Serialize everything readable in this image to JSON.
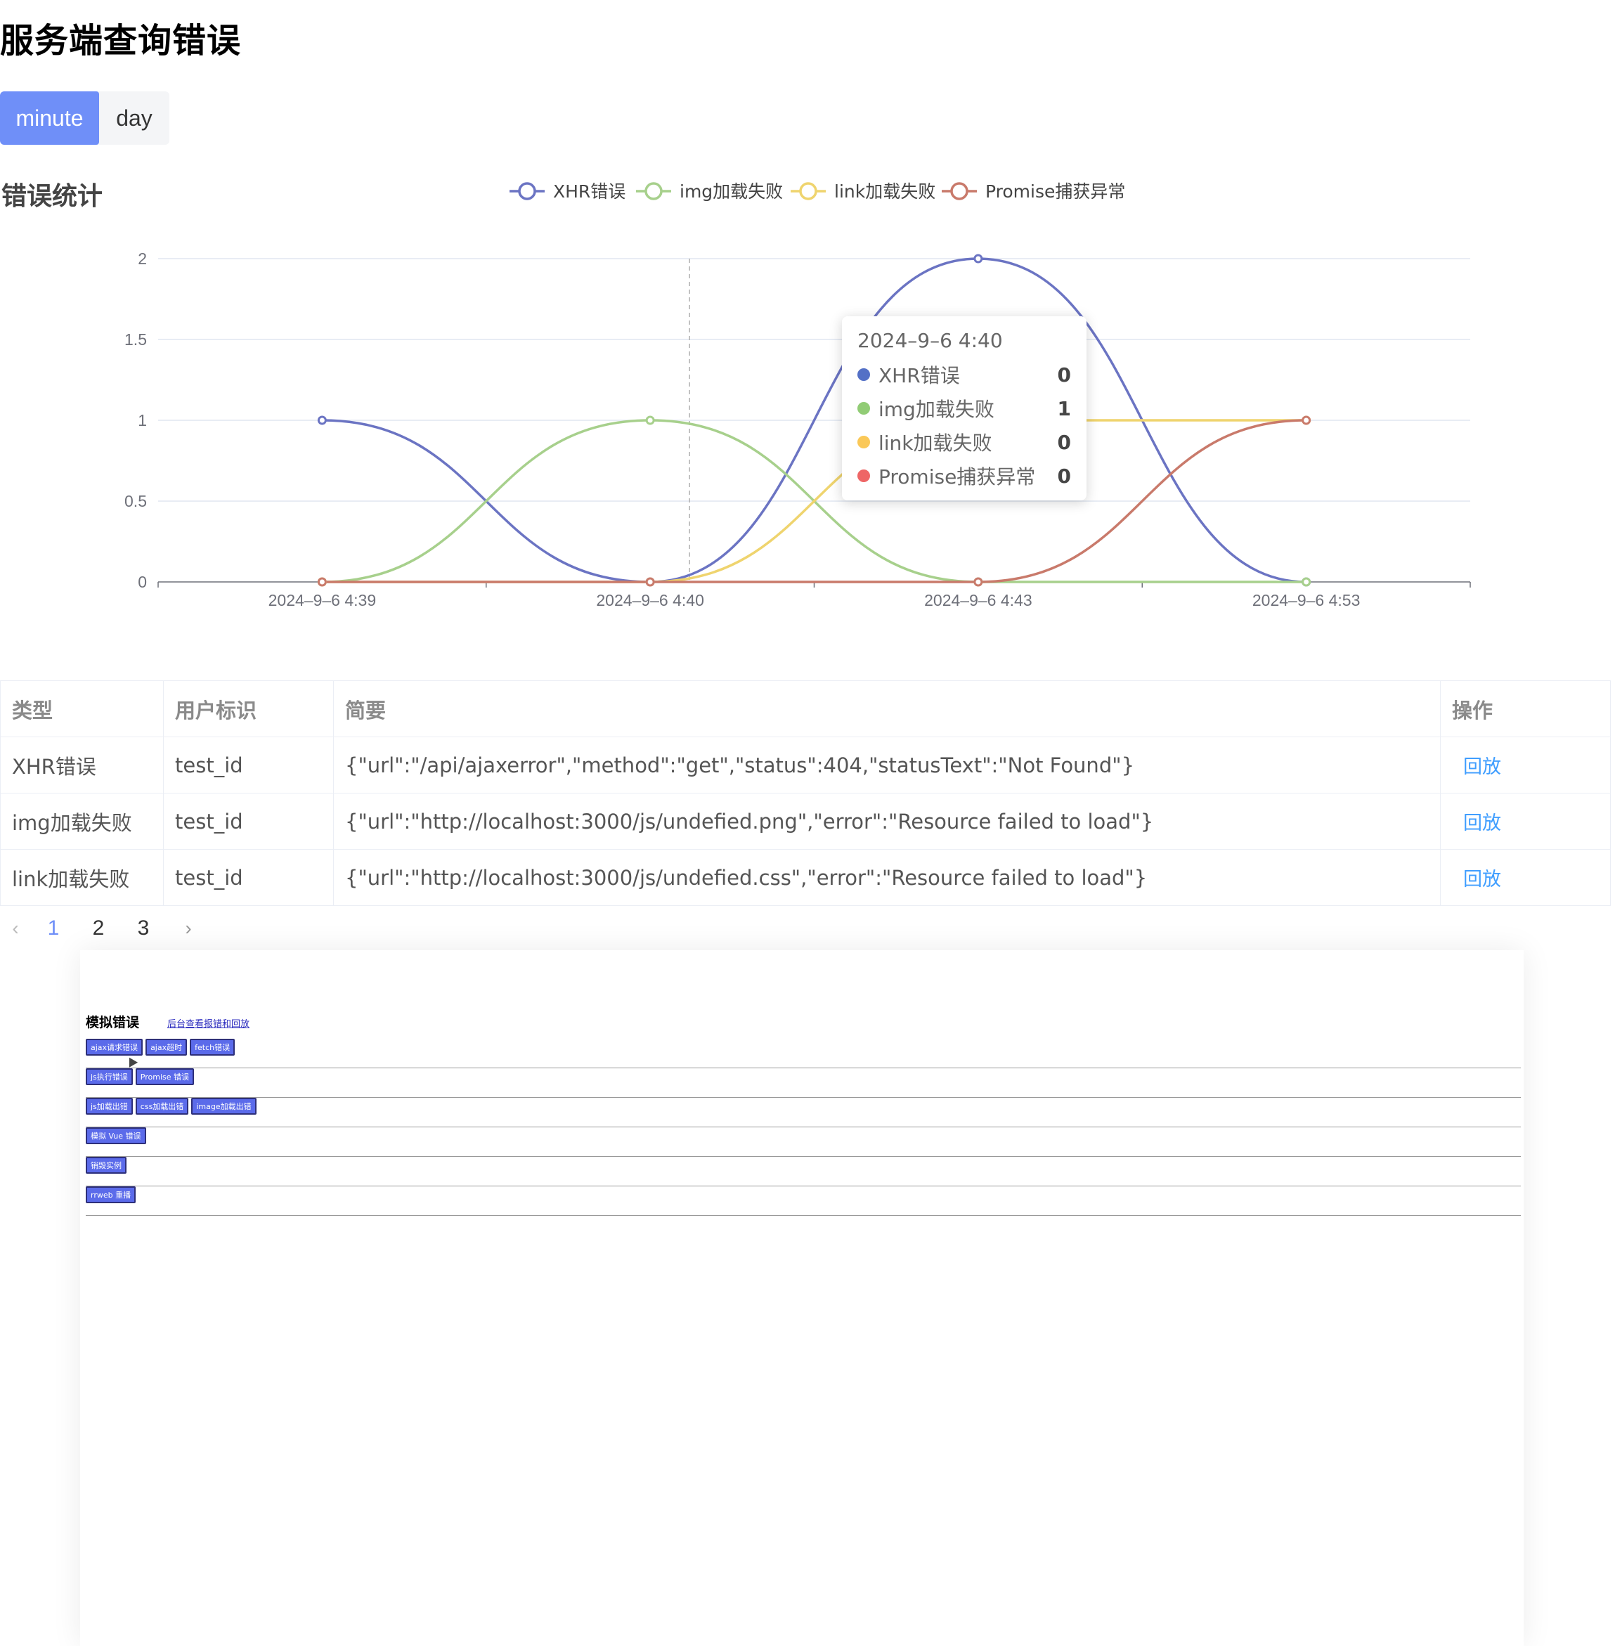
{
  "page": {
    "title": "服务端查询错误"
  },
  "granularity": {
    "options": [
      "minute",
      "day"
    ],
    "selected": "minute"
  },
  "chart": {
    "title": "错误统计",
    "tooltip": {
      "title": "2024–9–6 4:40",
      "rows": [
        {
          "name": "XHR错误",
          "value": "0",
          "color": "#5470c6"
        },
        {
          "name": "img加载失败",
          "value": "1",
          "color": "#91cc75"
        },
        {
          "name": "link加载失败",
          "value": "0",
          "color": "#fac858"
        },
        {
          "name": "Promise捕获异常",
          "value": "0",
          "color": "#ee6666"
        }
      ]
    }
  },
  "chart_data": {
    "type": "line",
    "smooth": true,
    "categories": [
      "2024–9–6 4:39",
      "2024–9–6 4:40",
      "2024–9–6 4:43",
      "2024–9–6 4:53"
    ],
    "ylim": [
      0,
      2
    ],
    "yticks": [
      "0",
      "0.5",
      "1",
      "1.5",
      "2"
    ],
    "legend_position": "top-center",
    "grid": true,
    "series": [
      {
        "name": "XHR错误",
        "color": "#6b74c3",
        "values": [
          1,
          0,
          2,
          0
        ]
      },
      {
        "name": "img加载失败",
        "color": "#a7d08c",
        "values": [
          0,
          1,
          0,
          0
        ]
      },
      {
        "name": "link加载失败",
        "color": "#efd46e",
        "values": [
          0,
          0,
          1,
          1
        ]
      },
      {
        "name": "Promise捕获异常",
        "color": "#c97a6b",
        "values": [
          0,
          0,
          0,
          1
        ]
      }
    ]
  },
  "table": {
    "headers": [
      "类型",
      "用户标识",
      "简要",
      "操作"
    ],
    "rows": [
      {
        "type": "XHR错误",
        "user": "test_id",
        "summary": "{\"url\":\"/api/ajaxerror\",\"method\":\"get\",\"status\":404,\"statusText\":\"Not Found\"}",
        "action": "回放"
      },
      {
        "type": "img加载失败",
        "user": "test_id",
        "summary": "{\"url\":\"http://localhost:3000/js/undefied.png\",\"error\":\"Resource failed to load\"}",
        "action": "回放"
      },
      {
        "type": "link加载失败",
        "user": "test_id",
        "summary": "{\"url\":\"http://localhost:3000/js/undefied.css\",\"error\":\"Resource failed to load\"}",
        "action": "回放"
      }
    ]
  },
  "pagination": {
    "prev": "‹",
    "pages": [
      "1",
      "2",
      "3"
    ],
    "current": "1",
    "next": "›"
  },
  "demo": {
    "title": "模拟错误",
    "link": "后台查看报错和回放",
    "rows": [
      [
        "ajax请求错误",
        "ajax超时",
        "fetch错误"
      ],
      [
        "js执行错误",
        "Promise 错误"
      ],
      [
        "js加载出错",
        "css加载出错",
        "image加载出错"
      ],
      [
        "模拟 Vue 错误"
      ],
      [
        "销毁实例"
      ],
      [
        "rrweb 重播"
      ]
    ]
  }
}
